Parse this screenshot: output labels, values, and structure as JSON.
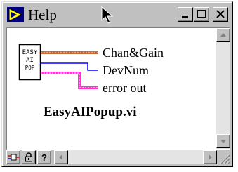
{
  "window": {
    "title": "Help"
  },
  "connector_pane": {
    "icon_lines": [
      "EASY",
      "AI",
      "POP"
    ],
    "terminals": [
      {
        "label": "Chan&Gain",
        "color": "#cc6633"
      },
      {
        "label": "DevNum",
        "color": "#0000ff"
      },
      {
        "label": "error out",
        "color": "#ff33cc"
      }
    ],
    "vi_name": "EasyAIPopup.vi"
  },
  "toolbar_icons": [
    "simple-diagram-icon",
    "lock-icon",
    "help-question-icon"
  ],
  "colors": {
    "chrome": "#c0c0c0",
    "content_bg": "#ffffff",
    "cluster_wire": "#cc6633",
    "numeric_wire": "#0000ff",
    "error_wire": "#ff33cc"
  }
}
